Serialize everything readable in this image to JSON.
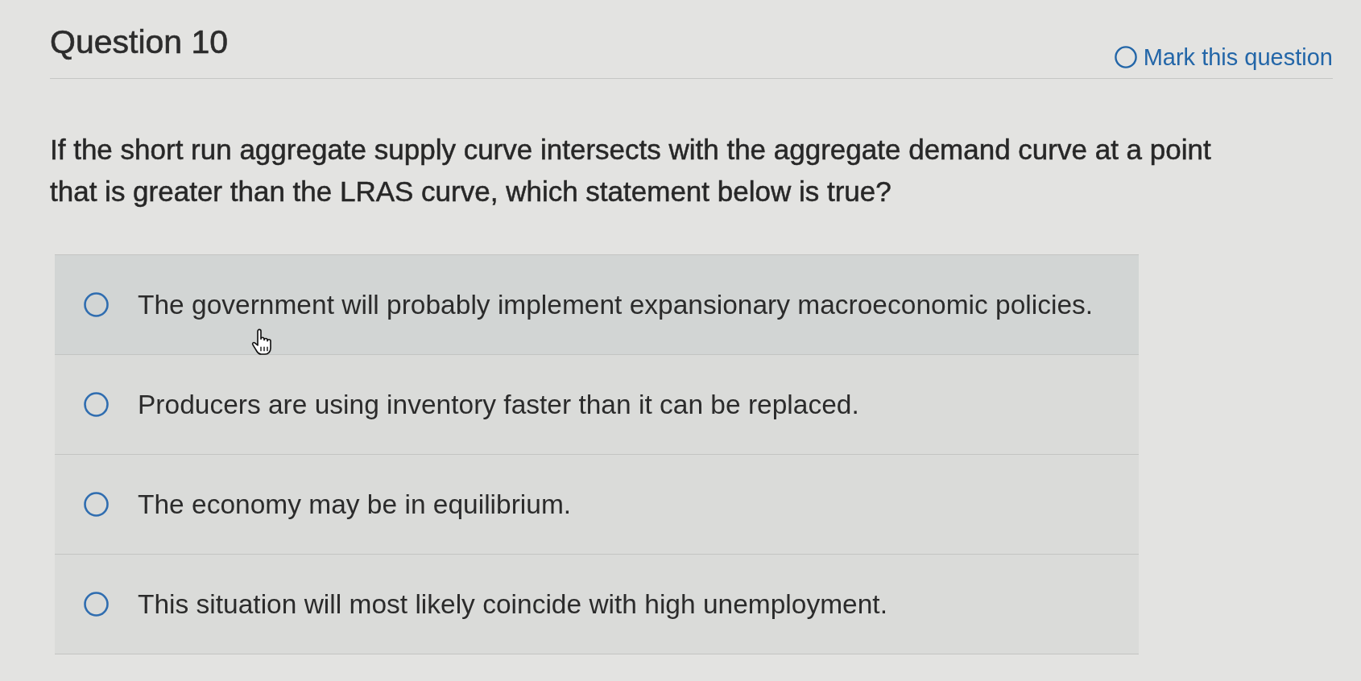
{
  "header": {
    "title": "Question 10",
    "mark": {
      "label": "Mark this question",
      "marked": false
    }
  },
  "question": {
    "text": "If the short run aggregate supply curve intersects with the aggregate demand curve at a point that is greater than the LRAS curve, which statement below is true?"
  },
  "options": [
    {
      "label": "The government will probably implement expansionary macroeconomic policies.",
      "selected": false,
      "hovered": true
    },
    {
      "label": "Producers are using inventory faster than it can be replaced.",
      "selected": false,
      "hovered": false
    },
    {
      "label": "The economy may be in equilibrium.",
      "selected": false,
      "hovered": false
    },
    {
      "label": "This situation will most likely coincide with high unemployment.",
      "selected": false,
      "hovered": false
    }
  ]
}
